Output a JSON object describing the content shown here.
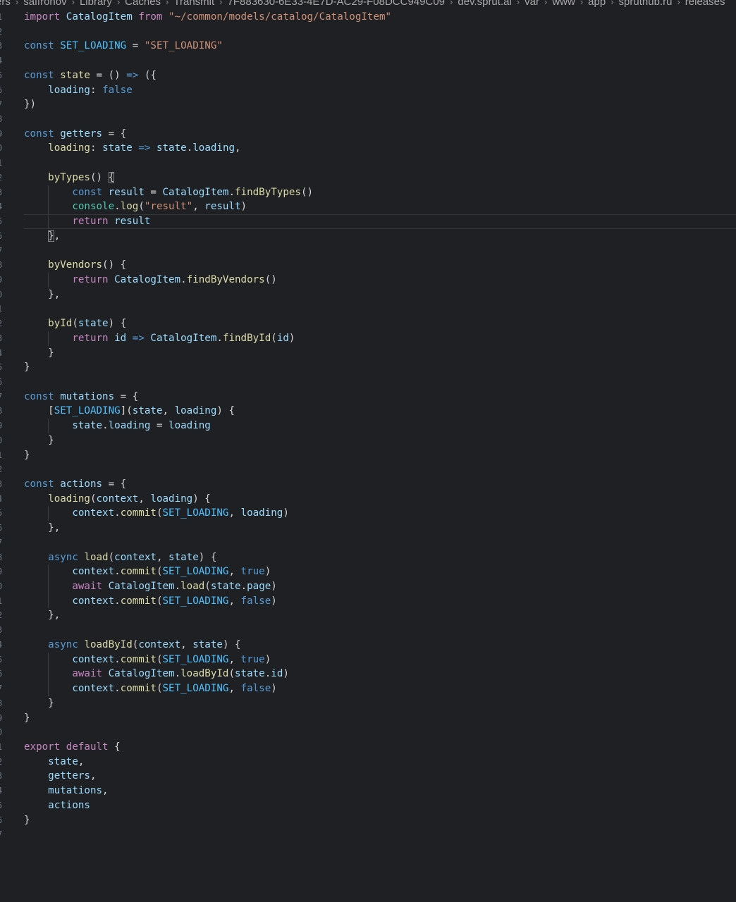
{
  "breadcrumb": [
    "ers",
    "saffronov",
    "Library",
    "Caches",
    "Transmit",
    "7F883630-6E33-4E7D-AC29-F08DCC949C09",
    "dev.sprut.ai",
    "var",
    "www",
    "app",
    "spruthub.ru",
    "releases"
  ],
  "line_numbers": [
    "1",
    "2",
    "3",
    "4",
    "5",
    "6",
    "7",
    "8",
    "9",
    "0",
    "1",
    "2",
    "3",
    "4",
    "5",
    "6",
    "7",
    "8",
    "9",
    "0",
    "1",
    "2",
    "3",
    "4",
    "5",
    "6",
    "7",
    "8",
    "9",
    "0",
    "1",
    "2",
    "3",
    "4",
    "5",
    "6",
    "7",
    "8",
    "9",
    "0",
    "1",
    "2",
    "3",
    "4",
    "5",
    "6",
    "7",
    "8",
    "9",
    "0",
    "1",
    "2",
    "3",
    "4",
    "5",
    "6",
    "7"
  ],
  "current_line": 15,
  "colors": {
    "background": "#1f2023",
    "keyword": "#569cd6",
    "control": "#c586c0",
    "function": "#dcdcaa",
    "variable": "#9cdcfe",
    "string": "#ce9178"
  },
  "code_lines": [
    [
      {
        "t": "import",
        "c": "ctrl"
      },
      {
        "t": " "
      },
      {
        "t": "CatalogItem",
        "c": "var"
      },
      {
        "t": " "
      },
      {
        "t": "from",
        "c": "ctrl"
      },
      {
        "t": " "
      },
      {
        "t": "\"~/common/models/catalog/CatalogItem\"",
        "c": "str"
      }
    ],
    [],
    [
      {
        "t": "const",
        "c": "kw"
      },
      {
        "t": " "
      },
      {
        "t": "SET_LOADING",
        "c": "const"
      },
      {
        "t": " = "
      },
      {
        "t": "\"SET_LOADING\"",
        "c": "str"
      }
    ],
    [],
    [
      {
        "t": "const",
        "c": "kw"
      },
      {
        "t": " "
      },
      {
        "t": "state",
        "c": "fn"
      },
      {
        "t": " = () "
      },
      {
        "t": "=>",
        "c": "kw"
      },
      {
        "t": " ({"
      }
    ],
    [
      {
        "t": "    "
      },
      {
        "t": "loading",
        "c": "var"
      },
      {
        "t": ": "
      },
      {
        "t": "false",
        "c": "bool"
      }
    ],
    [
      {
        "t": "})"
      }
    ],
    [],
    [
      {
        "t": "const",
        "c": "kw"
      },
      {
        "t": " "
      },
      {
        "t": "getters",
        "c": "var"
      },
      {
        "t": " = {"
      }
    ],
    [
      {
        "t": "    "
      },
      {
        "t": "loading",
        "c": "fn"
      },
      {
        "t": ": "
      },
      {
        "t": "state",
        "c": "var"
      },
      {
        "t": " "
      },
      {
        "t": "=>",
        "c": "kw"
      },
      {
        "t": " "
      },
      {
        "t": "state",
        "c": "var"
      },
      {
        "t": "."
      },
      {
        "t": "loading",
        "c": "var"
      },
      {
        "t": ","
      }
    ],
    [],
    [
      {
        "t": "    "
      },
      {
        "t": "byTypes",
        "c": "fn"
      },
      {
        "t": "() "
      },
      {
        "t": "{",
        "c": "match"
      }
    ],
    [
      {
        "t": "        "
      },
      {
        "t": "const",
        "c": "kw"
      },
      {
        "t": " "
      },
      {
        "t": "result",
        "c": "var"
      },
      {
        "t": " = "
      },
      {
        "t": "CatalogItem",
        "c": "var"
      },
      {
        "t": "."
      },
      {
        "t": "findByTypes",
        "c": "fn"
      },
      {
        "t": "()"
      }
    ],
    [
      {
        "t": "        "
      },
      {
        "t": "console",
        "c": "cls"
      },
      {
        "t": "."
      },
      {
        "t": "log",
        "c": "fn"
      },
      {
        "t": "("
      },
      {
        "t": "\"result\"",
        "c": "str"
      },
      {
        "t": ", "
      },
      {
        "t": "result",
        "c": "var"
      },
      {
        "t": ")"
      }
    ],
    [
      {
        "t": "        "
      },
      {
        "t": "return",
        "c": "ctrl"
      },
      {
        "t": " "
      },
      {
        "t": "result",
        "c": "var"
      }
    ],
    [
      {
        "t": "    "
      },
      {
        "t": "}",
        "c": "match"
      },
      {
        "t": ","
      }
    ],
    [],
    [
      {
        "t": "    "
      },
      {
        "t": "byVendors",
        "c": "fn"
      },
      {
        "t": "() {"
      }
    ],
    [
      {
        "t": "        "
      },
      {
        "t": "return",
        "c": "ctrl"
      },
      {
        "t": " "
      },
      {
        "t": "CatalogItem",
        "c": "var"
      },
      {
        "t": "."
      },
      {
        "t": "findByVendors",
        "c": "fn"
      },
      {
        "t": "()"
      }
    ],
    [
      {
        "t": "    },"
      }
    ],
    [],
    [
      {
        "t": "    "
      },
      {
        "t": "byId",
        "c": "fn"
      },
      {
        "t": "("
      },
      {
        "t": "state",
        "c": "var"
      },
      {
        "t": ") {"
      }
    ],
    [
      {
        "t": "        "
      },
      {
        "t": "return",
        "c": "ctrl"
      },
      {
        "t": " "
      },
      {
        "t": "id",
        "c": "var"
      },
      {
        "t": " "
      },
      {
        "t": "=>",
        "c": "kw"
      },
      {
        "t": " "
      },
      {
        "t": "CatalogItem",
        "c": "var"
      },
      {
        "t": "."
      },
      {
        "t": "findById",
        "c": "fn"
      },
      {
        "t": "("
      },
      {
        "t": "id",
        "c": "var"
      },
      {
        "t": ")"
      }
    ],
    [
      {
        "t": "    }"
      }
    ],
    [
      {
        "t": "}"
      }
    ],
    [],
    [
      {
        "t": "const",
        "c": "kw"
      },
      {
        "t": " "
      },
      {
        "t": "mutations",
        "c": "var"
      },
      {
        "t": " = {"
      }
    ],
    [
      {
        "t": "    ["
      },
      {
        "t": "SET_LOADING",
        "c": "const"
      },
      {
        "t": "]("
      },
      {
        "t": "state",
        "c": "var"
      },
      {
        "t": ", "
      },
      {
        "t": "loading",
        "c": "var"
      },
      {
        "t": ") {"
      }
    ],
    [
      {
        "t": "        "
      },
      {
        "t": "state",
        "c": "var"
      },
      {
        "t": "."
      },
      {
        "t": "loading",
        "c": "var"
      },
      {
        "t": " = "
      },
      {
        "t": "loading",
        "c": "var"
      }
    ],
    [
      {
        "t": "    }"
      }
    ],
    [
      {
        "t": "}"
      }
    ],
    [],
    [
      {
        "t": "const",
        "c": "kw"
      },
      {
        "t": " "
      },
      {
        "t": "actions",
        "c": "var"
      },
      {
        "t": " = {"
      }
    ],
    [
      {
        "t": "    "
      },
      {
        "t": "loading",
        "c": "fn"
      },
      {
        "t": "("
      },
      {
        "t": "context",
        "c": "var"
      },
      {
        "t": ", "
      },
      {
        "t": "loading",
        "c": "var"
      },
      {
        "t": ") {"
      }
    ],
    [
      {
        "t": "        "
      },
      {
        "t": "context",
        "c": "var"
      },
      {
        "t": "."
      },
      {
        "t": "commit",
        "c": "fn"
      },
      {
        "t": "("
      },
      {
        "t": "SET_LOADING",
        "c": "const"
      },
      {
        "t": ", "
      },
      {
        "t": "loading",
        "c": "var"
      },
      {
        "t": ")"
      }
    ],
    [
      {
        "t": "    },"
      }
    ],
    [],
    [
      {
        "t": "    "
      },
      {
        "t": "async",
        "c": "kw"
      },
      {
        "t": " "
      },
      {
        "t": "load",
        "c": "fn"
      },
      {
        "t": "("
      },
      {
        "t": "context",
        "c": "var"
      },
      {
        "t": ", "
      },
      {
        "t": "state",
        "c": "var"
      },
      {
        "t": ") {"
      }
    ],
    [
      {
        "t": "        "
      },
      {
        "t": "context",
        "c": "var"
      },
      {
        "t": "."
      },
      {
        "t": "commit",
        "c": "fn"
      },
      {
        "t": "("
      },
      {
        "t": "SET_LOADING",
        "c": "const"
      },
      {
        "t": ", "
      },
      {
        "t": "true",
        "c": "bool"
      },
      {
        "t": ")"
      }
    ],
    [
      {
        "t": "        "
      },
      {
        "t": "await",
        "c": "ctrl"
      },
      {
        "t": " "
      },
      {
        "t": "CatalogItem",
        "c": "var"
      },
      {
        "t": "."
      },
      {
        "t": "load",
        "c": "fn"
      },
      {
        "t": "("
      },
      {
        "t": "state",
        "c": "var"
      },
      {
        "t": "."
      },
      {
        "t": "page",
        "c": "var"
      },
      {
        "t": ")"
      }
    ],
    [
      {
        "t": "        "
      },
      {
        "t": "context",
        "c": "var"
      },
      {
        "t": "."
      },
      {
        "t": "commit",
        "c": "fn"
      },
      {
        "t": "("
      },
      {
        "t": "SET_LOADING",
        "c": "const"
      },
      {
        "t": ", "
      },
      {
        "t": "false",
        "c": "bool"
      },
      {
        "t": ")"
      }
    ],
    [
      {
        "t": "    },"
      }
    ],
    [],
    [
      {
        "t": "    "
      },
      {
        "t": "async",
        "c": "kw"
      },
      {
        "t": " "
      },
      {
        "t": "loadById",
        "c": "fn"
      },
      {
        "t": "("
      },
      {
        "t": "context",
        "c": "var"
      },
      {
        "t": ", "
      },
      {
        "t": "state",
        "c": "var"
      },
      {
        "t": ") {"
      }
    ],
    [
      {
        "t": "        "
      },
      {
        "t": "context",
        "c": "var"
      },
      {
        "t": "."
      },
      {
        "t": "commit",
        "c": "fn"
      },
      {
        "t": "("
      },
      {
        "t": "SET_LOADING",
        "c": "const"
      },
      {
        "t": ", "
      },
      {
        "t": "true",
        "c": "bool"
      },
      {
        "t": ")"
      }
    ],
    [
      {
        "t": "        "
      },
      {
        "t": "await",
        "c": "ctrl"
      },
      {
        "t": " "
      },
      {
        "t": "CatalogItem",
        "c": "var"
      },
      {
        "t": "."
      },
      {
        "t": "loadById",
        "c": "fn"
      },
      {
        "t": "("
      },
      {
        "t": "state",
        "c": "var"
      },
      {
        "t": "."
      },
      {
        "t": "id",
        "c": "var"
      },
      {
        "t": ")"
      }
    ],
    [
      {
        "t": "        "
      },
      {
        "t": "context",
        "c": "var"
      },
      {
        "t": "."
      },
      {
        "t": "commit",
        "c": "fn"
      },
      {
        "t": "("
      },
      {
        "t": "SET_LOADING",
        "c": "const"
      },
      {
        "t": ", "
      },
      {
        "t": "false",
        "c": "bool"
      },
      {
        "t": ")"
      }
    ],
    [
      {
        "t": "    }"
      }
    ],
    [
      {
        "t": "}"
      }
    ],
    [],
    [
      {
        "t": "export",
        "c": "ctrl"
      },
      {
        "t": " "
      },
      {
        "t": "default",
        "c": "ctrl"
      },
      {
        "t": " {"
      }
    ],
    [
      {
        "t": "    "
      },
      {
        "t": "state",
        "c": "var"
      },
      {
        "t": ","
      }
    ],
    [
      {
        "t": "    "
      },
      {
        "t": "getters",
        "c": "var"
      },
      {
        "t": ","
      }
    ],
    [
      {
        "t": "    "
      },
      {
        "t": "mutations",
        "c": "var"
      },
      {
        "t": ","
      }
    ],
    [
      {
        "t": "    "
      },
      {
        "t": "actions",
        "c": "var"
      }
    ],
    [
      {
        "t": "}"
      }
    ],
    []
  ]
}
